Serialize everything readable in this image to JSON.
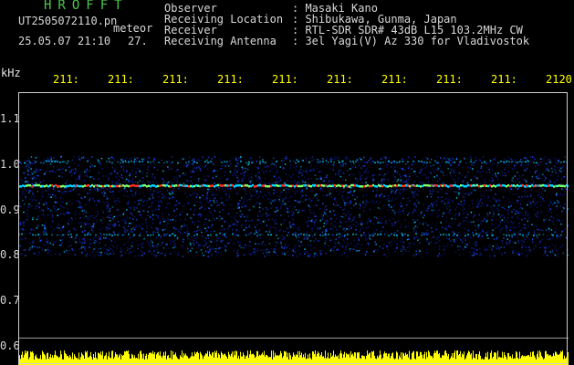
{
  "header": {
    "app_title": "HROFFT",
    "filename": "UT2505072110.pn",
    "mode_label": "meteor",
    "datetime": "25.05.07 21:10",
    "number": "27."
  },
  "info": [
    {
      "key": "Observer",
      "value": ": Masaki Kano"
    },
    {
      "key": "Receiving Location",
      "value": ": Shibukawa, Gunma, Japan"
    },
    {
      "key": "Receiver",
      "value": ": RTL-SDR SDR# 43dB L15 103.2MHz CW"
    },
    {
      "key": "Receiving Antenna",
      "value": ": 3el Yagi(V) Az 330 for Vladivostok"
    }
  ],
  "chart_data": {
    "type": "heatmap",
    "ylabel": "kHz",
    "yticks": [
      "1.1",
      "1.0",
      "0.9",
      "0.8",
      "0.7",
      "0.6"
    ],
    "yvalues": [
      1.1,
      1.0,
      0.9,
      0.8,
      0.7,
      0.6
    ],
    "xticks": [
      "211",
      "211",
      "211",
      "211",
      "211",
      "211",
      "211",
      "211",
      "211",
      "2120"
    ],
    "xticks_suffix": [
      ":",
      ":",
      ":",
      ":",
      ":",
      ":",
      ":",
      ":",
      ":",
      ""
    ],
    "ylim": [
      0.6,
      1.1
    ],
    "trace_freq_khz": 0.955,
    "secondary_traces_khz": [
      1.01,
      0.85
    ],
    "noise_band_khz": [
      0.8,
      1.02
    ],
    "colors": {
      "background": "#000000",
      "noise_low": "#0b1a8c",
      "noise_mid": "#1f4cff",
      "noise_high": "#00d4ff",
      "peak": "#ff3020",
      "axis_text": "#ffff00",
      "baseline_signal": "#ffff00"
    }
  }
}
